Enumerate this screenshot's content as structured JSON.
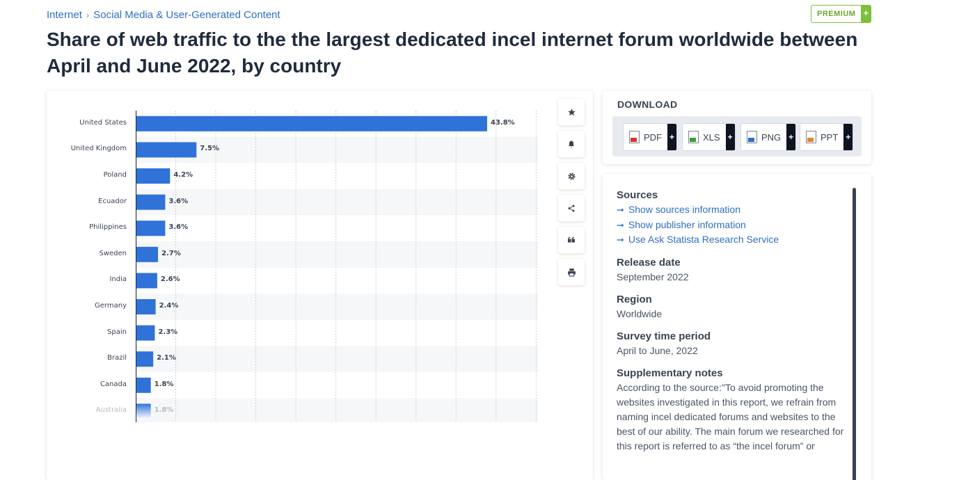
{
  "breadcrumb": {
    "item1": "Internet",
    "separator": "›",
    "item2": "Social Media & User-Generated Content"
  },
  "premium": {
    "label": "PREMIUM",
    "plus": "+"
  },
  "title": "Share of web traffic to the the largest dedicated incel internet forum worldwide between April and June 2022, by country",
  "toolbar": {
    "icons": [
      "star-icon",
      "bell-icon",
      "gear-icon",
      "share-icon",
      "quote-icon",
      "print-icon"
    ]
  },
  "download": {
    "title": "DOWNLOAD",
    "buttons": [
      {
        "label": "PDF",
        "icon": "pdf-file-icon",
        "color": "#d9322f"
      },
      {
        "label": "XLS",
        "icon": "xls-file-icon",
        "color": "#3e9b3a"
      },
      {
        "label": "PNG",
        "icon": "png-file-icon",
        "color": "#2f6fbf"
      },
      {
        "label": "PPT",
        "icon": "ppt-file-icon",
        "color": "#e3862b"
      }
    ],
    "plus": "+"
  },
  "info": {
    "sources_heading": "Sources",
    "links": [
      "Show sources information",
      "Show publisher information",
      "Use Ask Statista Research Service"
    ],
    "release_heading": "Release date",
    "release_value": "September 2022",
    "region_heading": "Region",
    "region_value": "Worldwide",
    "survey_heading": "Survey time period",
    "survey_value": "April to June, 2022",
    "notes_heading": "Supplementary notes",
    "notes_value": "According to the source:\"To avoid promoting the websites investigated in this report, we refrain from naming incel dedicated forums and websites to the best of our ability. The main forum we researched for this report is referred to as “the incel forum” or"
  },
  "chart_data": {
    "type": "bar",
    "orientation": "horizontal",
    "categories": [
      "United States",
      "United Kingdom",
      "Poland",
      "Ecuador",
      "Philippines",
      "Sweden",
      "India",
      "Germany",
      "Spain",
      "Brazil",
      "Canada",
      "Australia"
    ],
    "values": [
      43.8,
      7.5,
      4.2,
      3.6,
      3.6,
      2.7,
      2.6,
      2.4,
      2.3,
      2.1,
      1.8,
      1.8
    ],
    "value_labels": [
      "43.8%",
      "7.5%",
      "4.2%",
      "3.6%",
      "3.6%",
      "2.7%",
      "2.6%",
      "2.4%",
      "2.3%",
      "2.1%",
      "1.8%",
      "1.8%"
    ],
    "xlim": [
      0,
      50
    ],
    "grid": true,
    "bar_color": "#2f73d9"
  }
}
